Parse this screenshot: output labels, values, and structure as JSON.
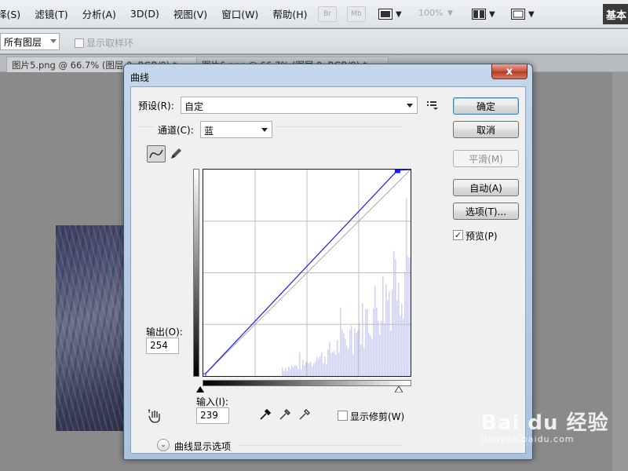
{
  "menubar": {
    "items": [
      "择(S)",
      "滤镜(T)",
      "分析(A)",
      "3D(D)",
      "视图(V)",
      "窗口(W)",
      "帮助(H)"
    ],
    "br_label": "Br",
    "mb_label": "Mb",
    "zoom": "100%",
    "workspace_label": "基本"
  },
  "options": {
    "sample_select": "所有图层",
    "show_ring_label": "显示取样环"
  },
  "tabs": [
    {
      "label": "图片5.png @ 66.7% (图层 0, RGB/8) *"
    },
    {
      "label": "图片6.png @ 66.7% (图层 0, RGB/8) *"
    }
  ],
  "dialog": {
    "title": "曲线",
    "close_label": "x",
    "preset_label": "预设(R):",
    "preset_value": "自定",
    "channel_label": "通道(C):",
    "channel_value": "蓝",
    "output_label": "输出(O):",
    "output_value": "254",
    "input_label": "输入(I):",
    "input_value": "239",
    "show_clipping_label": "显示修剪(W)",
    "curve_options_label": "曲线显示选项",
    "buttons": {
      "ok": "确定",
      "cancel": "取消",
      "smooth": "平滑(M)",
      "auto": "自动(A)",
      "options": "选项(T)..."
    },
    "preview_label": "预览(P)",
    "preview_checked": true,
    "curve": {
      "channel_color": "#1a1aff",
      "points": [
        [
          0,
          0
        ],
        [
          239,
          254
        ],
        [
          255,
          255
        ]
      ]
    }
  },
  "watermark": {
    "main": "Bai du 经验",
    "sub": "jingyan.baidu.com"
  }
}
